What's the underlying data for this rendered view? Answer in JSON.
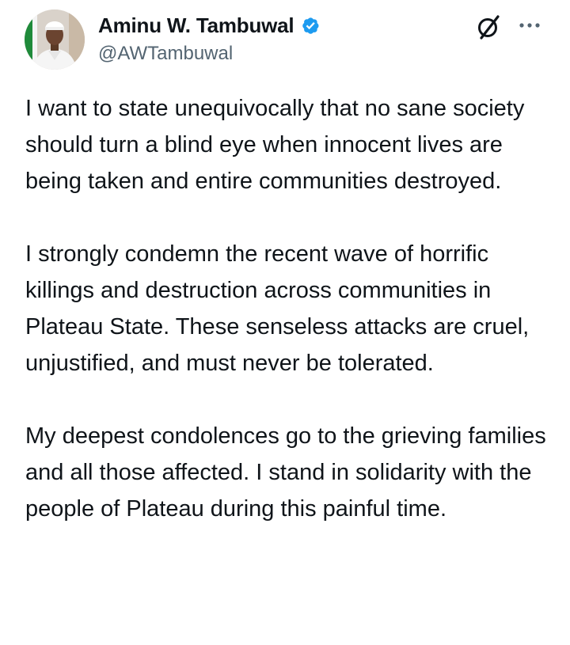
{
  "author": {
    "display_name": "Aminu W. Tambuwal",
    "handle": "@AWTambuwal",
    "verified": true,
    "avatar_icon": "profile-photo"
  },
  "actions": {
    "grok_icon": "grok-icon",
    "more_icon": "more-options-icon"
  },
  "tweet": {
    "paragraphs": [
      "I want to state unequivocally that no sane society should turn a blind eye when innocent lives are being taken and entire communities destroyed.",
      "I strongly condemn the recent wave of horrific killings and destruction across communities in Plateau State. These senseless attacks are cruel, unjustified, and must never be tolerated.",
      "My deepest condolences go to the grieving families and all those affected. I stand in solidarity with the people of Plateau during this painful time."
    ]
  },
  "colors": {
    "text_primary": "#0f1419",
    "text_secondary": "#536471",
    "verified_blue": "#1d9bf0"
  }
}
